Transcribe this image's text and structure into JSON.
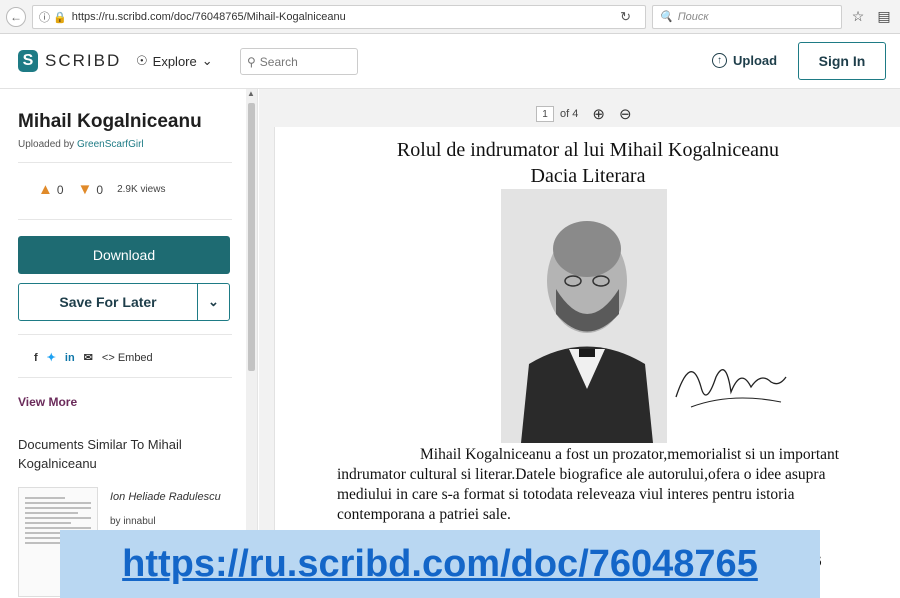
{
  "browser": {
    "url": "https://ru.scribd.com/doc/76048765/Mihail-Kogalniceanu",
    "search_placeholder": "Поиск"
  },
  "header": {
    "logo_text": "SCRIBD",
    "explore_label": "Explore",
    "search_placeholder": "Search",
    "upload_label": "Upload",
    "signin_label": "Sign In"
  },
  "sidebar": {
    "title": "Mihail Kogalniceanu",
    "uploaded_by_prefix": "Uploaded by ",
    "uploader": "GreenScarfGirl",
    "likes": "0",
    "dislikes": "0",
    "views": "2.9K views",
    "download_label": "Download",
    "save_label": "Save For Later",
    "embed_label": "Embed",
    "view_more": "View More",
    "similar_title": "Documents Similar To Mihail Kogalniceanu",
    "similar_item": {
      "author": "Ion Heliade Radulescu",
      "by": "by innabul"
    }
  },
  "viewer": {
    "page_number": "1",
    "page_total": "of 4",
    "doc_title": "Rolul de indrumator al lui Mihail Kogalniceanu",
    "doc_subtitle": "Dacia Literara",
    "paragraph_first": "Mihail Kogalniceanu a fost un prozator,memorialist si un important",
    "paragraph_rest": "indrumator cultural si literar.Datele biografice ale autorului,ofera o idee asupra mediului in care s-a format si totodata releveaza viul interes pentru istoria contemporana a patriei sale.",
    "tail_1": "i",
    "tail_2": "6"
  },
  "overlay": {
    "url": "https://ru.scribd.com/doc/76048765"
  },
  "colors": {
    "brand": "#1e7b85",
    "download_bg": "#1e6b72",
    "view_more": "#6b2b5b",
    "banner_bg": "#b9d7f2",
    "banner_link": "#1466c8"
  }
}
